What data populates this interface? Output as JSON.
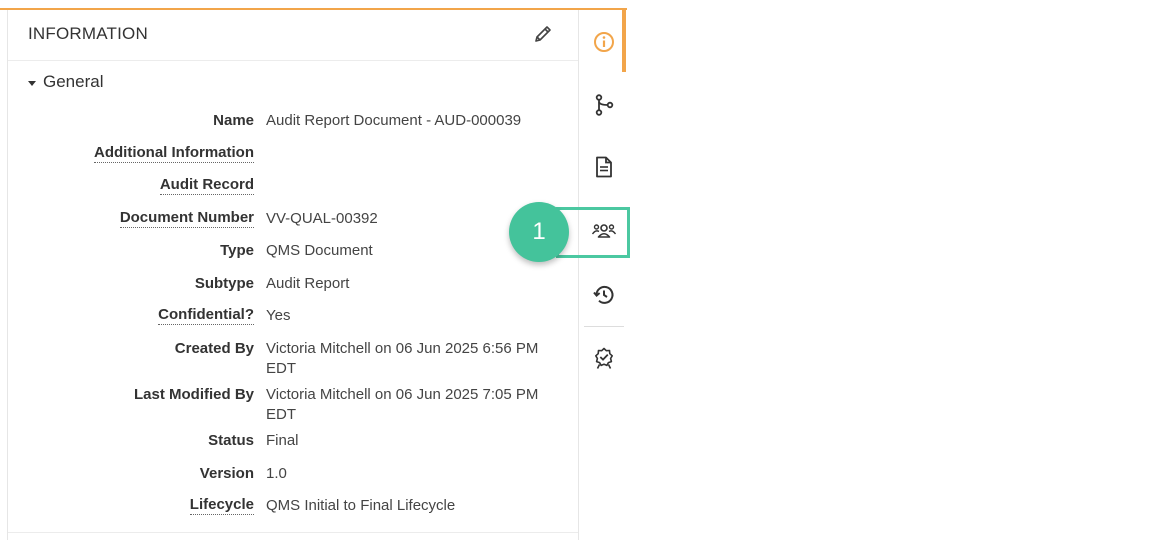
{
  "panel": {
    "title": "INFORMATION",
    "section_label": "General"
  },
  "fields": [
    {
      "label": "Name",
      "value": "Audit Report Document - AUD-000039"
    },
    {
      "label": "Additional Information",
      "value": ""
    },
    {
      "label": "Audit Record",
      "value": ""
    },
    {
      "label": "Document Number",
      "value": "VV-QUAL-00392"
    },
    {
      "label": "Type",
      "value": "QMS Document"
    },
    {
      "label": "Subtype",
      "value": "Audit Report"
    },
    {
      "label": "Confidential?",
      "value": "Yes"
    },
    {
      "label": "Created By",
      "value": "Victoria Mitchell on 06 Jun 2025 6:56 PM EDT"
    },
    {
      "label": "Last Modified By",
      "value": "Victoria Mitchell on 06 Jun 2025 7:05 PM EDT"
    },
    {
      "label": "Status",
      "value": "Final"
    },
    {
      "label": "Version",
      "value": "1.0"
    },
    {
      "label": "Lifecycle",
      "value": "QMS Initial to Final Lifecycle"
    }
  ],
  "rail": {
    "icons": [
      "info-icon",
      "workflow-branch-icon",
      "document-icon",
      "users-icon",
      "history-icon",
      "certificate-icon"
    ],
    "active_icon": "info-icon"
  },
  "callout": {
    "step_number": "1",
    "color": "#44c39b"
  },
  "colors": {
    "accent": "#f2a54a",
    "highlight": "#4bc8a1"
  }
}
